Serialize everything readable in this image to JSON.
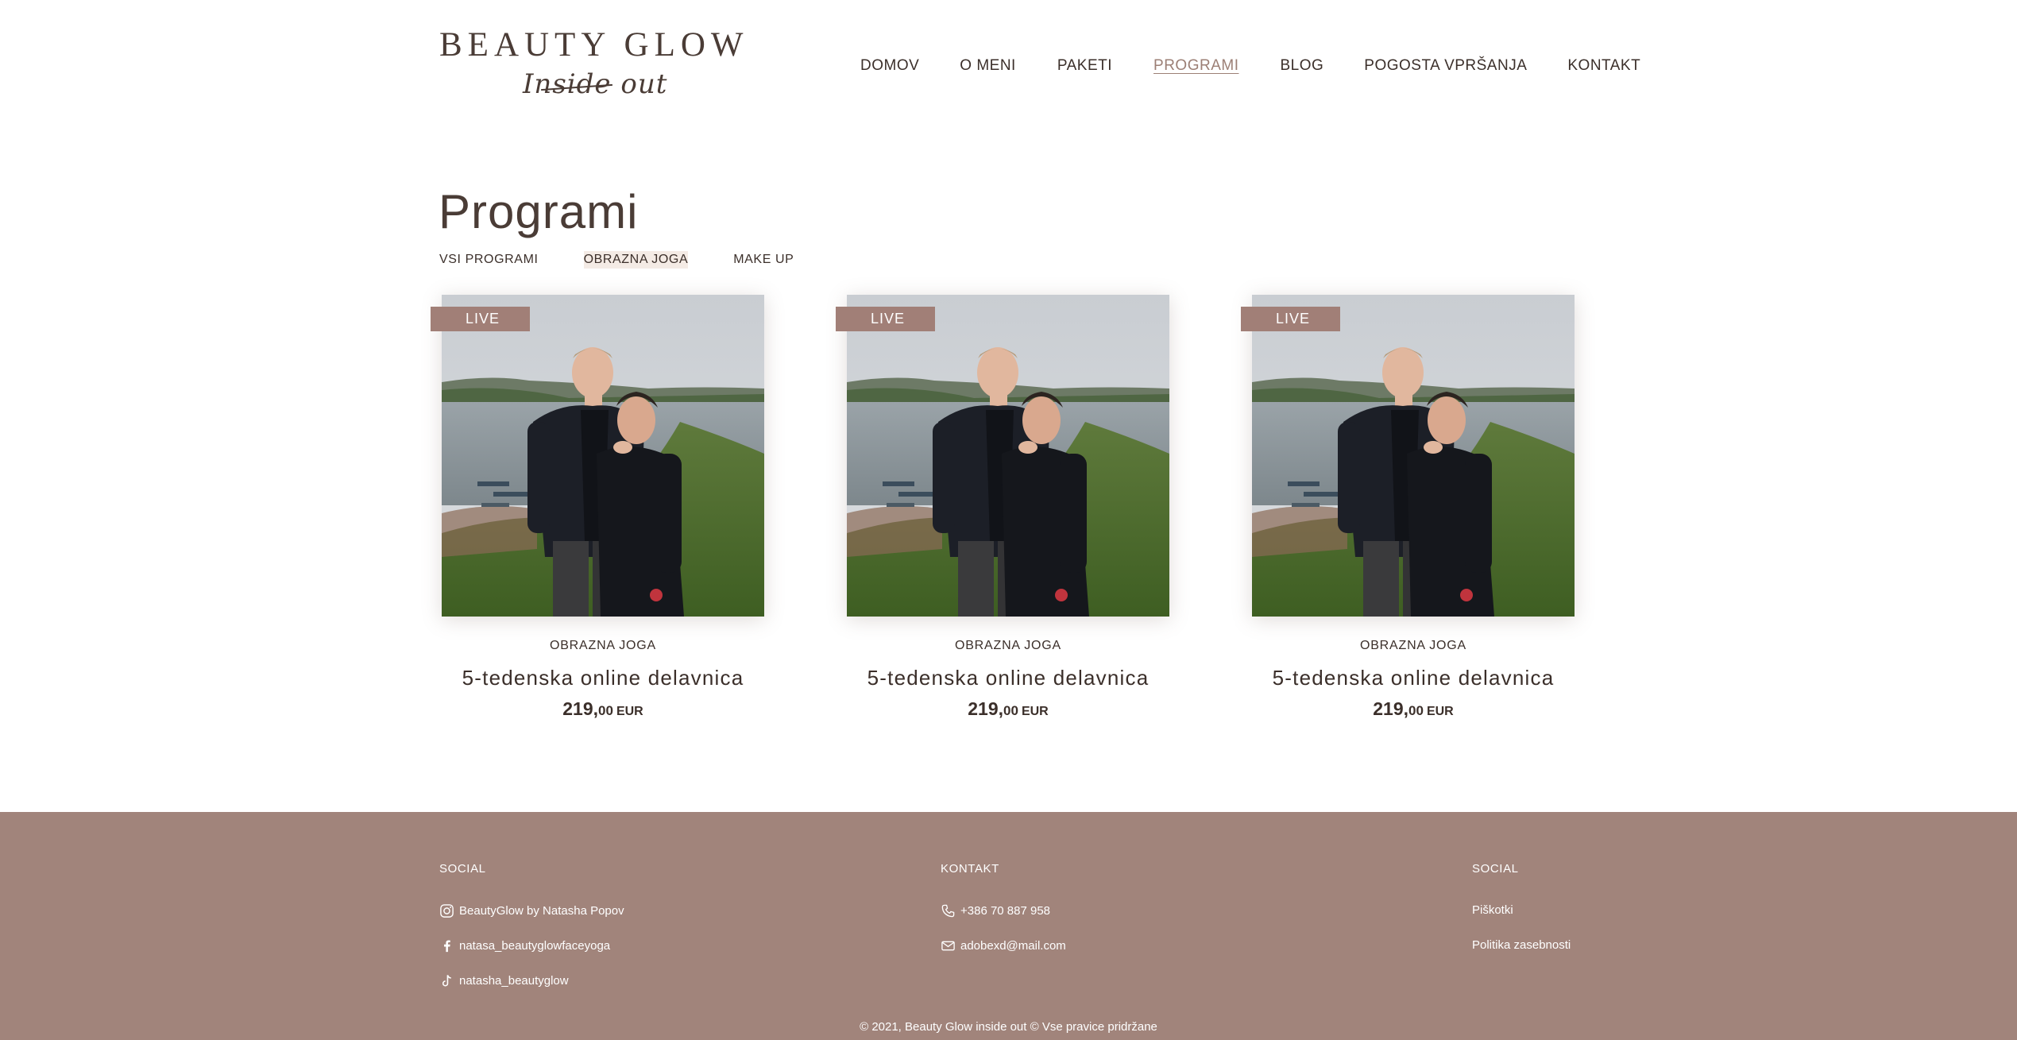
{
  "header": {
    "logo_title": "BEAUTY GLOW",
    "logo_script": "Inside out",
    "nav": [
      {
        "label": "DOMOV",
        "active": false
      },
      {
        "label": "O MENI",
        "active": false
      },
      {
        "label": "PAKETI",
        "active": false
      },
      {
        "label": "PROGRAMI",
        "active": true
      },
      {
        "label": "BLOG",
        "active": false
      },
      {
        "label": "POGOSTA VPRŠANJA",
        "active": false
      },
      {
        "label": "KONTAKT",
        "active": false
      }
    ]
  },
  "main": {
    "title": "Programi",
    "filters": [
      {
        "label": "VSI PROGRAMI",
        "active": false
      },
      {
        "label": "OBRAZNA JOGA",
        "active": true
      },
      {
        "label": "MAKE UP",
        "active": false
      }
    ],
    "cards": [
      {
        "badge": "LIVE",
        "category": "OBRAZNA JOGA",
        "title": "5-tedenska online delavnica",
        "price_int": "219,",
        "price_dec": "00",
        "currency": "EUR"
      },
      {
        "badge": "LIVE",
        "category": "OBRAZNA JOGA",
        "title": "5-tedenska online delavnica",
        "price_int": "219,",
        "price_dec": "00",
        "currency": "EUR"
      },
      {
        "badge": "LIVE",
        "category": "OBRAZNA JOGA",
        "title": "5-tedenska online delavnica",
        "price_int": "219,",
        "price_dec": "00",
        "currency": "EUR"
      }
    ]
  },
  "footer": {
    "col1": {
      "heading": "SOCIAL",
      "links": [
        {
          "icon": "instagram-icon",
          "label": "BeautyGlow by Natasha Popov"
        },
        {
          "icon": "facebook-icon",
          "label": "natasa_beautyglowfaceyoga"
        },
        {
          "icon": "tiktok-icon",
          "label": "natasha_beautyglow"
        }
      ]
    },
    "col2": {
      "heading": "KONTAKT",
      "links": [
        {
          "icon": "phone-icon",
          "label": "+386 70 887 958"
        },
        {
          "icon": "mail-icon",
          "label": "adobexd@mail.com"
        }
      ]
    },
    "col3": {
      "heading": "SOCIAL",
      "links": [
        {
          "label": "Piškotki"
        },
        {
          "label": "Politika zasebnosti"
        }
      ]
    },
    "copyright": "© 2021, Beauty Glow inside out © Vse pravice pridržane"
  },
  "colors": {
    "text": "#4a3c36",
    "accent": "#9c7f75",
    "badge": "#a17f77",
    "footer_bg": "#a1847b"
  }
}
